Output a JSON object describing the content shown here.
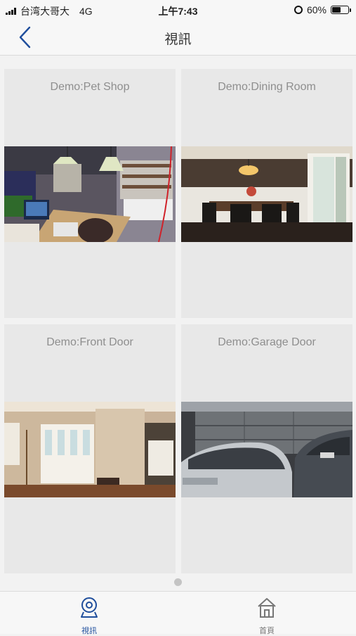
{
  "status_bar": {
    "carrier": "台湾大哥大",
    "network": "4G",
    "time": "上午7:43",
    "battery_text": "60%",
    "battery_level": 0.6
  },
  "nav": {
    "title": "視訊",
    "back_icon": "chevron-left-icon",
    "accent_color": "#1f4e9c"
  },
  "cameras": [
    {
      "label": "Demo:Pet Shop",
      "scene": "pet-shop"
    },
    {
      "label": "Demo:Dining Room",
      "scene": "dining-room"
    },
    {
      "label": "Demo:Front Door",
      "scene": "front-door"
    },
    {
      "label": "Demo:Garage Door",
      "scene": "garage-door"
    }
  ],
  "tabs": [
    {
      "label": "視訊",
      "icon": "webcam-icon",
      "active": true
    },
    {
      "label": "首頁",
      "icon": "home-icon",
      "active": false
    }
  ]
}
